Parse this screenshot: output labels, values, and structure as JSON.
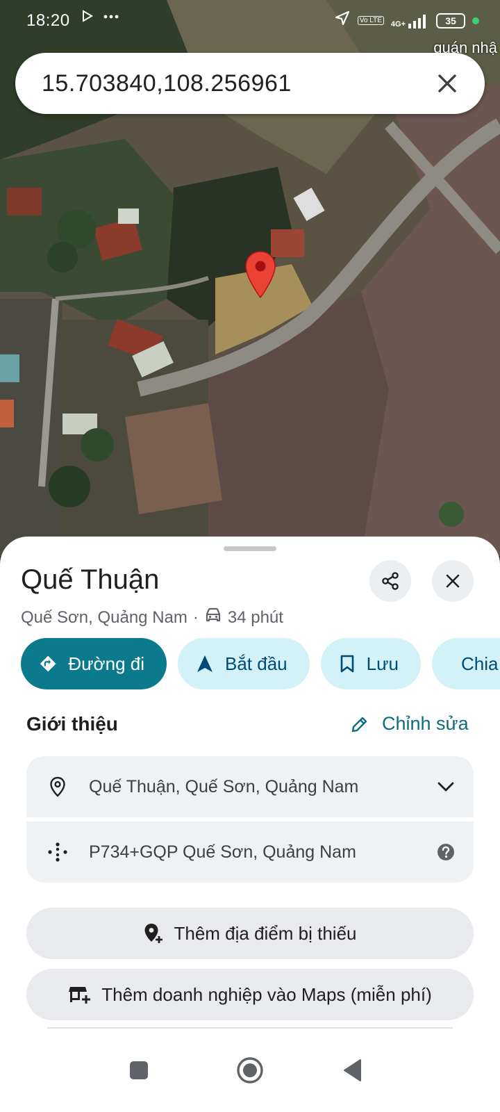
{
  "status_bar": {
    "time": "18:20",
    "left_icons": [
      "play-icon",
      "more-icon"
    ],
    "network_label": "4G+",
    "volte_label": "Vo LTE",
    "battery": "35"
  },
  "map": {
    "label_top_right": "quán nhậ",
    "search_query": "15.703840,108.256961"
  },
  "place": {
    "name": "Quế Thuận",
    "region": "Quế Sơn, Quảng Nam",
    "separator": "·",
    "drive_time": "34 phút"
  },
  "actions": {
    "directions": "Đường đi",
    "start": "Bắt đầu",
    "save": "Lưu",
    "share": "Chia sẻ"
  },
  "about": {
    "title": "Giới thiệu",
    "edit": "Chỉnh sửa",
    "address": "Quế Thuận, Quế Sơn, Quảng Nam",
    "plus_code": "P734+GQP Quế Sơn, Quảng Nam"
  },
  "buttons": {
    "add_missing_place": "Thêm địa điểm bị thiếu",
    "add_business": "Thêm doanh nghiệp vào Maps (miễn phí)"
  },
  "colors": {
    "primary": "#0b7a8c",
    "chip_bg": "#d3f2f8",
    "marker": "#ea4335"
  }
}
